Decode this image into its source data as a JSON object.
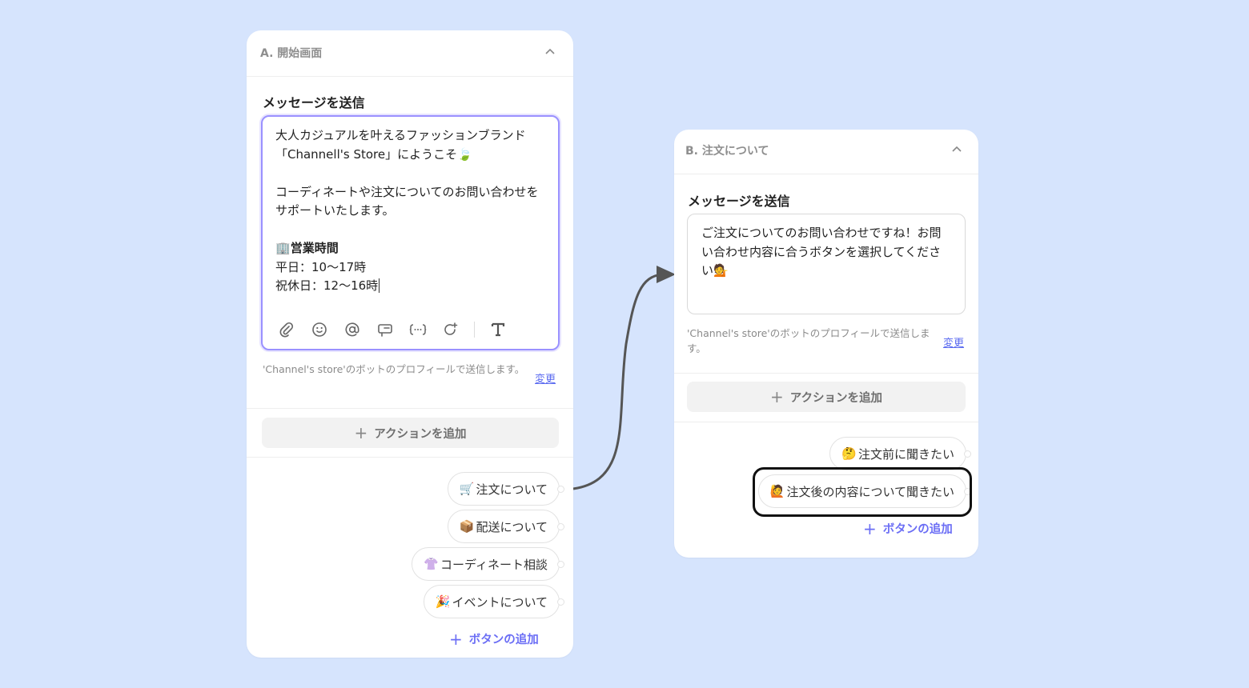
{
  "card_a": {
    "title": "A. 開始画面",
    "section_title": "メッセージを送信",
    "message_p1": "大人カジュアルを叶えるファッションブランド「Channell's Store」にようこそ🍃",
    "message_p2": "コーディネートや注文についてのお問い合わせをサポートいたします。",
    "hours_icon": "🏢",
    "hours_title": "営業時間",
    "hours_weekday": "平日：10〜17時",
    "hours_holiday": "祝休日：12〜16時",
    "profile_note": "'Channel's store'のボットのプロフィールで送信します。",
    "change_label": "変更",
    "add_action_label": "アクションを追加",
    "buttons": [
      {
        "emoji": "🛒",
        "label": "注文について"
      },
      {
        "emoji": "📦",
        "label": "配送について"
      },
      {
        "emoji": "👚",
        "label": "コーディネート相談"
      },
      {
        "emoji": "🎉",
        "label": "イベントについて"
      }
    ],
    "add_button_label": "ボタンの追加"
  },
  "card_b": {
    "title": "B. 注文について",
    "section_title": "メッセージを送信",
    "message": "ご注文についてのお問い合わせですね！お問い合わせ内容に合うボタンを選択してください💁",
    "profile_note": "'Channel's store'のボットのプロフィールで送信します。",
    "change_label": "変更",
    "add_action_label": "アクションを追加",
    "buttons": [
      {
        "emoji": "🤔",
        "label": "注文前に聞きたい"
      },
      {
        "emoji": "🙋",
        "label": "注文後の内容について聞きたい"
      }
    ],
    "add_button_label": "ボタンの追加"
  },
  "toolbar_icons": [
    "paperclip-icon",
    "emoji-icon",
    "mention-icon",
    "tag-icon",
    "variable-icon",
    "refresh-icon",
    "text-format-icon"
  ],
  "colors": {
    "background": "#d6e4fd",
    "accent": "#6b6ef5",
    "active_border": "#9a91ff",
    "highlight": "#111111"
  }
}
